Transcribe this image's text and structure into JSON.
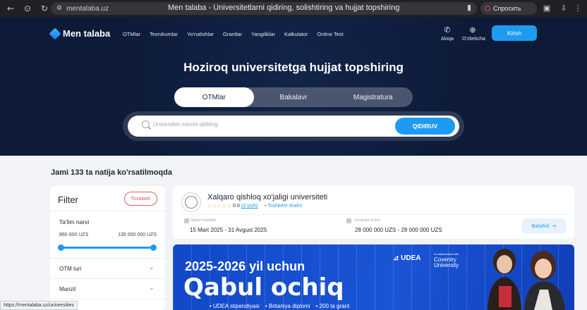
{
  "browser": {
    "url": "mentalaba.uz",
    "tab_title": "Men talaba - Universitetlarni qidiring, solishtiring va hujjat topshiring",
    "ask_label": "Спросить",
    "status_url": "https://mentalaba.uz/universities"
  },
  "header": {
    "brand": "Men talaba",
    "nav": [
      "OTMlar",
      "Texnikumlar",
      "Yo'nalishlar",
      "Grantlar",
      "Yangiliklar",
      "Kalkulator",
      "Online Test"
    ],
    "contact_label": "Aloqa",
    "language_label": "O'zbekcha",
    "login_label": "Kirish"
  },
  "hero": {
    "title": "Hoziroq universitetga hujjat topshiring",
    "tabs": [
      {
        "label": "OTMlar",
        "active": true
      },
      {
        "label": "Bakalavr",
        "active": false
      },
      {
        "label": "Magistratura",
        "active": false
      }
    ],
    "search_placeholder": "Universitet nomini qidiring",
    "search_button": "QIDIRUV"
  },
  "results": {
    "count_text": "Jami 133 ta natija ko'rsatilmoqda"
  },
  "filter": {
    "title": "Filter",
    "clear_label": "Tozalash",
    "price_label": "Ta'lim narxi",
    "price_min": "860 000 UZS",
    "price_max": "135 000 000 UZS",
    "slider_range": [
      0,
      1
    ],
    "sections": [
      "OTM turi",
      "Manzil"
    ]
  },
  "university_card": {
    "name": "Xalqaro qishloq xo'jaligi universiteti",
    "stars": "☆☆☆☆☆",
    "rating": "0.0",
    "reviews": "(0 izoh)",
    "city": "Toshkent shahri",
    "admission_label": "Qabul muddati",
    "admission_value": "15 Mart 2025 - 31 Avgust 2025",
    "contract_label": "Kontrakt to'lovi",
    "contract_value": "28 000 000 UZS - 28 000 000 UZS",
    "details_button": "Batafsil"
  },
  "banner": {
    "line1": "2025-2026 yil uchun",
    "line2": "Qabul ochiq",
    "partner1": "UDEA",
    "partner2_small": "in collaboration with",
    "partner2": "Coventry",
    "partner2_b": "University",
    "bullets": [
      "• UDEA stipendiyasi",
      "• Britaniya diplomi",
      "• 200 ta grant"
    ]
  },
  "colors": {
    "hero_bg": "#0d1b38",
    "accent": "#1e9bf0",
    "banner_bg": "#1348c4"
  }
}
